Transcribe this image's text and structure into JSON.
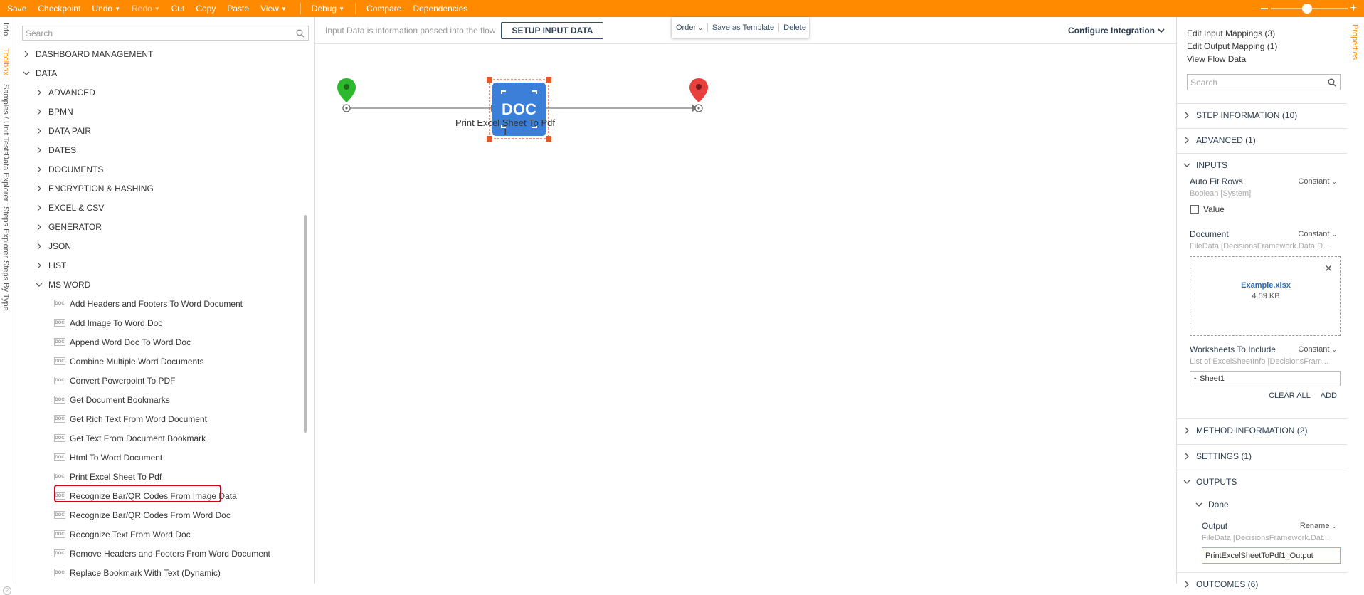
{
  "toolbar": {
    "items": [
      {
        "label": "Save",
        "disabled": false,
        "caret": false
      },
      {
        "label": "Checkpoint",
        "disabled": false,
        "caret": false
      },
      {
        "label": "Undo",
        "disabled": false,
        "caret": true
      },
      {
        "label": "Redo",
        "disabled": true,
        "caret": true
      },
      {
        "label": "Cut",
        "disabled": false,
        "caret": false
      },
      {
        "label": "Copy",
        "disabled": false,
        "caret": false
      },
      {
        "label": "Paste",
        "disabled": false,
        "caret": false
      },
      {
        "label": "View",
        "disabled": false,
        "caret": true
      }
    ],
    "debug_label": "Debug",
    "compare_label": "Compare",
    "dependencies_label": "Dependencies"
  },
  "left_tabs": [
    "Info",
    "Toolbox",
    "Samples / Unit Tests",
    "Data Explorer",
    "Steps Explorer",
    "Steps By Type"
  ],
  "toolbox": {
    "search_placeholder": "Search",
    "tree": [
      {
        "label": "DASHBOARD MANAGEMENT",
        "level": 0,
        "kind": "folder",
        "open": false
      },
      {
        "label": "DATA",
        "level": 0,
        "kind": "folder",
        "open": true
      },
      {
        "label": "ADVANCED",
        "level": 1,
        "kind": "folder",
        "open": false
      },
      {
        "label": "BPMN",
        "level": 1,
        "kind": "folder",
        "open": false
      },
      {
        "label": "DATA PAIR",
        "level": 1,
        "kind": "folder",
        "open": false
      },
      {
        "label": "DATES",
        "level": 1,
        "kind": "folder",
        "open": false
      },
      {
        "label": "DOCUMENTS",
        "level": 1,
        "kind": "folder",
        "open": false
      },
      {
        "label": "ENCRYPTION & HASHING",
        "level": 1,
        "kind": "folder",
        "open": false
      },
      {
        "label": "EXCEL & CSV",
        "level": 1,
        "kind": "folder",
        "open": false
      },
      {
        "label": "GENERATOR",
        "level": 1,
        "kind": "folder",
        "open": false
      },
      {
        "label": "JSON",
        "level": 1,
        "kind": "folder",
        "open": false
      },
      {
        "label": "LIST",
        "level": 1,
        "kind": "folder",
        "open": false
      },
      {
        "label": "MS WORD",
        "level": 1,
        "kind": "folder",
        "open": true
      },
      {
        "label": "Add Headers and Footers To Word Document",
        "level": 2,
        "kind": "step"
      },
      {
        "label": "Add Image To Word Doc",
        "level": 2,
        "kind": "step"
      },
      {
        "label": "Append Word Doc To Word Doc",
        "level": 2,
        "kind": "step"
      },
      {
        "label": "Combine Multiple Word Documents",
        "level": 2,
        "kind": "step"
      },
      {
        "label": "Convert Powerpoint To PDF",
        "level": 2,
        "kind": "step"
      },
      {
        "label": "Get Document Bookmarks",
        "level": 2,
        "kind": "step"
      },
      {
        "label": "Get Rich Text From Word Document",
        "level": 2,
        "kind": "step"
      },
      {
        "label": "Get Text From Document Bookmark",
        "level": 2,
        "kind": "step"
      },
      {
        "label": "Html To Word Document",
        "level": 2,
        "kind": "step"
      },
      {
        "label": "Print Excel Sheet To Pdf",
        "level": 2,
        "kind": "step"
      },
      {
        "label": "Recognize Bar/QR Codes From Image Data",
        "level": 2,
        "kind": "step"
      },
      {
        "label": "Recognize Bar/QR Codes From Word Doc",
        "level": 2,
        "kind": "step"
      },
      {
        "label": "Recognize Text From Word Doc",
        "level": 2,
        "kind": "step"
      },
      {
        "label": "Remove Headers and Footers From Word Document",
        "level": 2,
        "kind": "step"
      },
      {
        "label": "Replace Bookmark With Text (Dynamic)",
        "level": 2,
        "kind": "step"
      }
    ],
    "step_icon_text": "DOC"
  },
  "canvas": {
    "info_text": "Input Data is information passed into the flow",
    "setup_button": "SETUP INPUT DATA",
    "configure_integration": "Configure Integration",
    "context_menu": {
      "order": "Order",
      "save_template": "Save as Template",
      "delete": "Delete"
    },
    "step": {
      "icon_text": "DOC",
      "label": "Print Excel Sheet To Pdf",
      "number": "1"
    },
    "colors": {
      "start": "#2db82d",
      "end": "#e8403c",
      "step": "#3b7fd9",
      "selection": "#e8572a"
    }
  },
  "properties": {
    "links": [
      "Edit Input Mappings (3)",
      "Edit Output Mapping (1)",
      "View Flow Data"
    ],
    "search_placeholder": "Search",
    "sections": {
      "step_info": "STEP INFORMATION (10)",
      "advanced": "ADVANCED (1)",
      "inputs": "INPUTS",
      "method_info": "METHOD INFORMATION (2)",
      "settings": "SETTINGS (1)",
      "outputs": "OUTPUTS",
      "outcomes": "OUTCOMES (6)"
    },
    "auto_fit": {
      "name": "Auto Fit Rows",
      "mode": "Constant",
      "type": "Boolean [System]",
      "checkbox_label": "Value"
    },
    "document": {
      "name": "Document",
      "mode": "Constant",
      "type": "FileData [DecisionsFramework.Data.D...",
      "file_name": "Example.xlsx",
      "file_size": "4.59 KB"
    },
    "worksheets": {
      "name": "Worksheets To Include",
      "mode": "Constant",
      "type": "List of ExcelSheetInfo [DecisionsFram...",
      "items": [
        "Sheet1"
      ],
      "clear_all": "CLEAR ALL",
      "add": "ADD"
    },
    "outputs": {
      "path": "Done",
      "name": "Output",
      "mode": "Rename",
      "type": "FileData [DecisionsFramework.Dat...",
      "value": "PrintExcelSheetToPdf1_Output"
    }
  },
  "right_tabs": [
    "Properties"
  ],
  "accent": "#ff8a00"
}
